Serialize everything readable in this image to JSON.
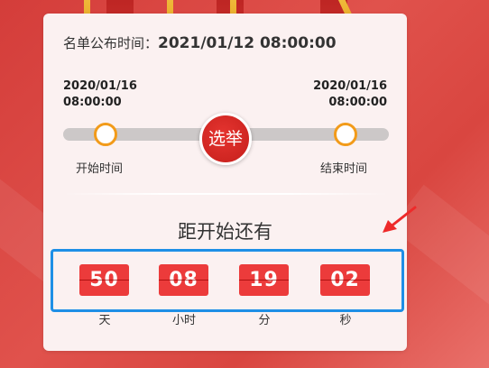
{
  "publish": {
    "label": "名单公布时间：",
    "value": "2021/01/12 08:00:00"
  },
  "timeline": {
    "start_date": "2020/01/16",
    "start_time": "08:00:00",
    "end_date": "2020/01/16",
    "end_time": "08:00:00",
    "center_label": "选举",
    "start_label": "开始时间",
    "end_label": "结束时间"
  },
  "countdown": {
    "title": "距开始还有",
    "days": "50",
    "days_label": "天",
    "hours": "08",
    "hours_label": "小时",
    "minutes": "19",
    "minutes_label": "分",
    "seconds": "02",
    "seconds_label": "秒"
  },
  "colors": {
    "accent_red": "#ec3b3b",
    "knob_orange": "#f29b1a",
    "highlight_blue": "#1e8fe6",
    "background_red": "#d94640"
  }
}
